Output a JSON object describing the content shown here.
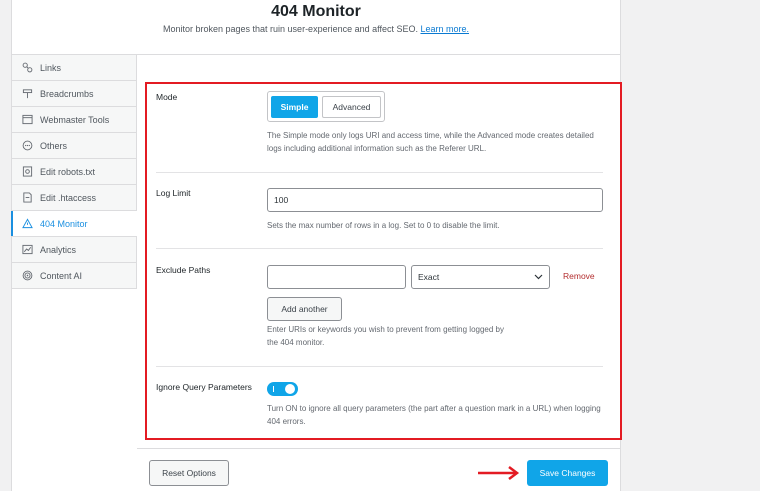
{
  "header": {
    "title": "404 Monitor",
    "subtitle": "Monitor broken pages that ruin user-experience and affect SEO.",
    "learn_more": "Learn more."
  },
  "sidebar": {
    "items": [
      {
        "label": "Links",
        "icon": "link-icon"
      },
      {
        "label": "Breadcrumbs",
        "icon": "signpost-icon"
      },
      {
        "label": "Webmaster Tools",
        "icon": "browser-window-icon"
      },
      {
        "label": "Others",
        "icon": "circle-dots-icon"
      },
      {
        "label": "Edit robots.txt",
        "icon": "robot-file-icon"
      },
      {
        "label": "Edit .htaccess",
        "icon": "file-icon"
      },
      {
        "label": "404 Monitor",
        "icon": "warning-triangle-icon"
      },
      {
        "label": "Analytics",
        "icon": "chart-icon"
      },
      {
        "label": "Content AI",
        "icon": "fingerprint-icon"
      }
    ],
    "active_index": 6
  },
  "settings": {
    "mode": {
      "label": "Mode",
      "options": [
        "Simple",
        "Advanced"
      ],
      "selected": "Simple",
      "help": "The Simple mode only logs URI and access time, while the Advanced mode creates detailed logs including additional information such as the Referer URL."
    },
    "log_limit": {
      "label": "Log Limit",
      "value": "100",
      "help": "Sets the max number of rows in a log. Set to 0 to disable the limit."
    },
    "exclude_paths": {
      "label": "Exclude Paths",
      "path_value": "",
      "match_type": "Exact",
      "remove_label": "Remove",
      "add_label": "Add another",
      "help": "Enter URIs or keywords you wish to prevent from getting logged by the 404 monitor."
    },
    "ignore_query": {
      "label": "Ignore Query Parameters",
      "enabled": true,
      "help": "Turn ON to ignore all query parameters (the part after a question mark in a URL) when logging 404 errors."
    }
  },
  "footer": {
    "reset_label": "Reset Options",
    "save_label": "Save Changes"
  },
  "colors": {
    "accent": "#10a5e8",
    "annotation": "#e31b23",
    "remove": "#b32d2e"
  }
}
